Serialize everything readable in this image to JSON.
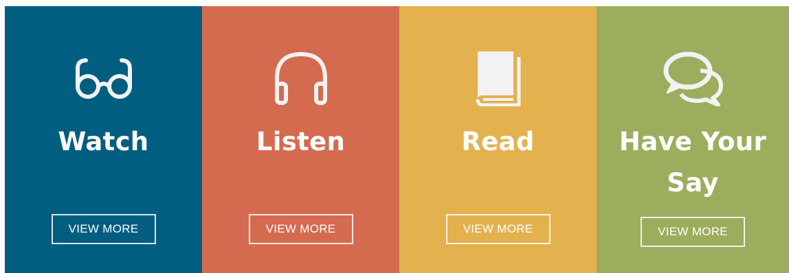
{
  "panels": [
    {
      "id": "watch",
      "title": "Watch",
      "button_label": "VIEW MORE",
      "icon": "glasses-icon",
      "color": "#015E80"
    },
    {
      "id": "listen",
      "title": "Listen",
      "button_label": "VIEW MORE",
      "icon": "headphones-icon",
      "color": "#D46B4F"
    },
    {
      "id": "read",
      "title": "Read",
      "button_label": "VIEW MORE",
      "icon": "book-icon",
      "color": "#E4B14F"
    },
    {
      "id": "have-your-say",
      "title": "Have Your Say",
      "button_label": "VIEW MORE",
      "icon": "speech-bubbles-icon",
      "color": "#9CAD5E"
    }
  ]
}
